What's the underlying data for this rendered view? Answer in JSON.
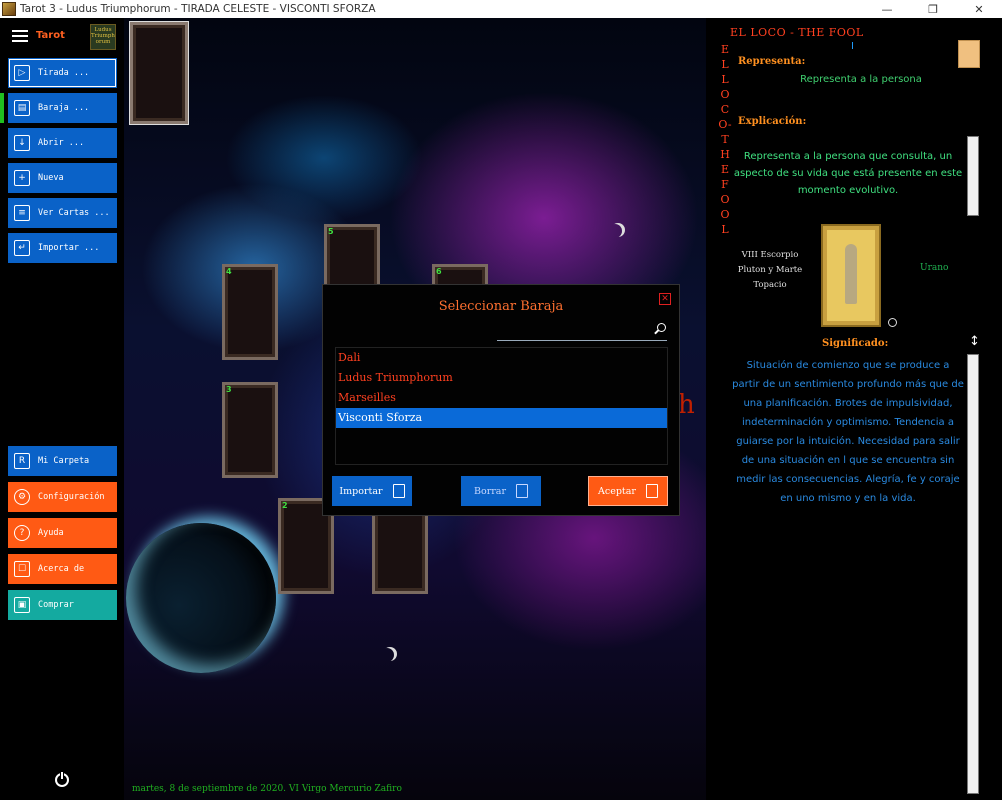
{
  "window": {
    "title": "Tarot 3 - Ludus Triumphorum - TIRADA CELESTE - VISCONTI SFORZA",
    "minimize_glyph": "—",
    "maximize_glyph": "❐",
    "close_glyph": "✕"
  },
  "sidebar": {
    "brand": "Tarot",
    "logo_text": "Ludus Triumphorum",
    "top_buttons": [
      {
        "label": "Tirada ...",
        "icon": "play-icon",
        "glyph": "▷"
      },
      {
        "label": "Baraja ...",
        "icon": "deck-icon",
        "glyph": "▤"
      },
      {
        "label": "Abrir ...",
        "icon": "open-file-icon",
        "glyph": "↓"
      },
      {
        "label": "Nueva",
        "icon": "new-file-icon",
        "glyph": "+"
      },
      {
        "label": "Ver Cartas ...",
        "icon": "view-cards-icon",
        "glyph": "≡"
      },
      {
        "label": "Importar ...",
        "icon": "import-icon",
        "glyph": "↵"
      }
    ],
    "bottom_buttons": [
      {
        "label": "Mi Carpeta",
        "icon": "folder-icon",
        "glyph": "R",
        "color": "#0a62c8"
      },
      {
        "label": "Configuración",
        "icon": "gear-icon",
        "glyph": "⚙",
        "color": "#ff5a14"
      },
      {
        "label": "Ayuda",
        "icon": "help-icon",
        "glyph": "?",
        "color": "#ff5a14"
      },
      {
        "label": "Acerca de",
        "icon": "about-icon",
        "glyph": "☐",
        "color": "#ff5a14"
      },
      {
        "label": "Comprar",
        "icon": "buy-icon",
        "glyph": "▣",
        "color": "#14aaa0"
      }
    ]
  },
  "stage": {
    "card_numbers": {
      "c2": "2",
      "c3": "3",
      "c4": "4",
      "c5": "5",
      "c6": "6"
    },
    "overlay_text": "h",
    "date": "martes, 8 de septiembre de 2020. VI Virgo Mercurio Zafiro"
  },
  "dialog": {
    "title": "Seleccionar Baraja",
    "close_glyph": "✕",
    "decks": [
      "Dali",
      "Ludus Triumphorum",
      "Marseilles",
      "Visconti Sforza"
    ],
    "selected_index": 3,
    "buttons": {
      "import": "Importar",
      "delete": "Borrar",
      "accept": "Aceptar"
    }
  },
  "panel": {
    "card_title": "EL LOCO - THE FOOL",
    "vertical_title": "ELLOCO-THEFOOL",
    "roman": "I",
    "represents_label": "Representa:",
    "represents_text": "Representa a la persona",
    "explanation_label": "Explicación:",
    "explanation_text": "Representa a la persona que consulta, un aspecto de su vida que está presente en este momento evolutivo.",
    "astro_lines": [
      "VIII Escorpio",
      "Pluton y Marte",
      "Topacio"
    ],
    "planet": "Urano",
    "meaning_label": "Significado:",
    "meaning_text": "Situación de comienzo que se produce a partir de un sentimiento profundo más que de una planificación. Brotes de impulsividad, indeterminación y optimismo. Tendencia a guiarse por la intuición. Necesidad para salir de una situación en l que se encuentra sin medir las consecuencias. Alegría, fe y coraje en uno mismo y en la vida.",
    "resize_glyph": "↕"
  }
}
